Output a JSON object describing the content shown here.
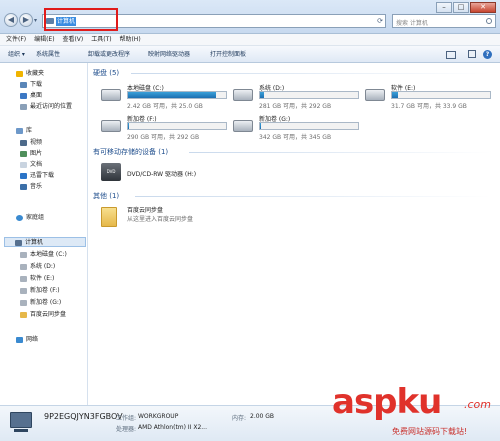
{
  "window": {
    "address_text": "计算机",
    "search_placeholder": "搜索 计算机"
  },
  "menu": [
    "文件(F)",
    "编辑(E)",
    "查看(V)",
    "工具(T)",
    "帮助(H)"
  ],
  "toolbar": [
    "组织 ▾",
    "系统属性",
    "卸载或更改程序",
    "映射网络驱动器",
    "打开控制面板"
  ],
  "nav": {
    "favorites": "收藏夹",
    "downloads": "下载",
    "desktop": "桌面",
    "recent": "最近访问的位置",
    "libraries": "库",
    "videos": "视频",
    "pictures": "图片",
    "documents": "文档",
    "xunlei": "迅雷下载",
    "music": "音乐",
    "homegroup": "家庭组",
    "computer": "计算机",
    "drive_c": "本地磁盘 (C:)",
    "drive_d": "系统 (D:)",
    "drive_e": "软件 (E:)",
    "drive_f": "新加卷 (F:)",
    "drive_g": "新加卷 (G:)",
    "baidu": "百度云同步盘",
    "network": "网络"
  },
  "groups": {
    "hdd": "硬盘 (5)",
    "removable": "有可移动存储的设备 (1)",
    "other": "其他 (1)"
  },
  "drives": [
    {
      "name": "本地磁盘 (C:)",
      "free": "2.42 GB 可用，共 25.0 GB",
      "used_fraction": 0.9
    },
    {
      "name": "系统 (D:)",
      "free": "281 GB 可用，共 292 GB",
      "used_fraction": 0.04
    },
    {
      "name": "软件 (E:)",
      "free": "31.7 GB 可用，共 33.9 GB",
      "used_fraction": 0.06
    },
    {
      "name": "新加卷 (F:)",
      "free": "290 GB 可用，共 292 GB",
      "used_fraction": 0.01
    },
    {
      "name": "新加卷 (G:)",
      "free": "342 GB 可用，共 345 GB",
      "used_fraction": 0.01
    }
  ],
  "dvd": {
    "name": "DVD/CD-RW 驱动器 (H:)",
    "icon_text": "DVD"
  },
  "other_item": {
    "name": "百度云同步盘",
    "desc": "从这里进入百度云同步盘"
  },
  "details": {
    "computer_name": "9P2EGQJYN3FGBOV",
    "workgroup_label": "工作组:",
    "workgroup": "WORKGROUP",
    "memory_label": "内存:",
    "memory": "2.00 GB",
    "cpu_label": "处理器:",
    "cpu": "AMD Athlon(tm) II X2..."
  },
  "watermark": {
    "brand": "aspku",
    "tld": ".com",
    "slogan": "免费网站源码下载站!"
  },
  "colors": {
    "accent": "#3b8de1",
    "highlight_box": "#e01b1b",
    "watermark": "#e0322b"
  }
}
